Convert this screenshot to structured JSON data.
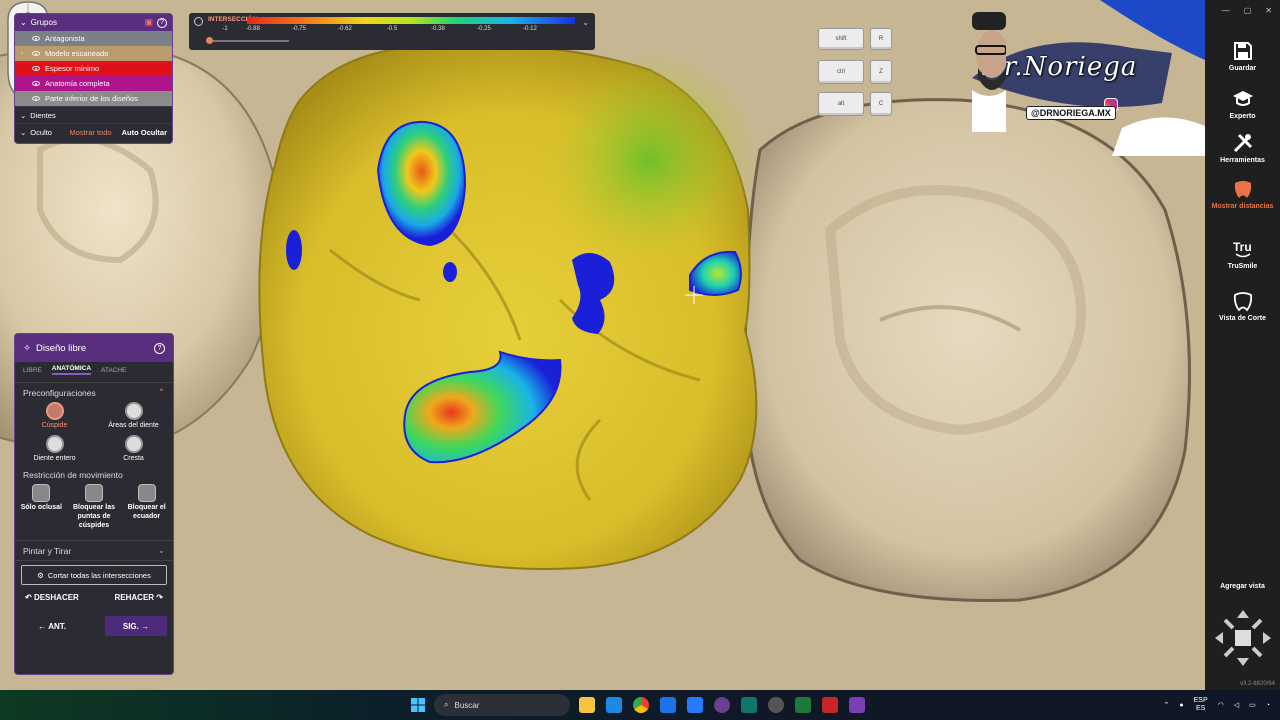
{
  "groups_panel": {
    "title": "Grupos",
    "layers": [
      {
        "label": "Antagonista",
        "bg": "#7a7f88",
        "arrow": ""
      },
      {
        "label": "Modelo escaneado",
        "bg": "#b99b6e",
        "arrow": "›"
      },
      {
        "label": "Espesor mínimo",
        "bg": "#e0101a",
        "arrow": ""
      },
      {
        "label": "Anatomía completa",
        "bg": "#b0148a",
        "arrow": ""
      },
      {
        "label": "Parte inferior de los diseños",
        "bg": "#8b8b8b",
        "arrow": ""
      }
    ],
    "teeth_label": "Dientes",
    "hidden_label": "Oculto",
    "show_all_label": "Mostrar todo",
    "auto_hide_label": "Auto Ocultar"
  },
  "intersection_bar": {
    "title": "INTERSECCIÓN",
    "ticks": [
      "-1",
      "-0.88",
      "-0.75",
      "-0.62",
      "-0.5",
      "-0.38",
      "-0.25",
      "-0.12"
    ],
    "slider_value": 0
  },
  "keys": {
    "shift": "shift",
    "ctrl": "ctrl",
    "alt": "alt",
    "r": "R",
    "z": "Z",
    "c": "C"
  },
  "logo": {
    "signature": "Dr.Noriega",
    "handle": "@DRNORIEGA.MX"
  },
  "design_panel": {
    "title": "Diseño libre",
    "tabs": [
      "LIBRE",
      "ANATÓMICA",
      "ATACHE"
    ],
    "active_tab": "ANATÓMICA",
    "presets_title": "Preconfiguraciones",
    "presets": [
      "Cúspide",
      "Áreas del diente",
      "Diente entero",
      "Cresta"
    ],
    "selected_preset": "Cúspide",
    "restriction_title": "Restricción de movimiento",
    "restrictions": [
      "Sólo oclusal",
      "Bloquear las puntas de cúspides",
      "Bloquear el ecuador"
    ],
    "paint_pull": "Pintar y Tirar",
    "cut_all": "Cortar todas las intersecciones",
    "undo": "DESHACER",
    "redo": "REHACER",
    "prev": "ANT.",
    "next": "SIG."
  },
  "sidebar": {
    "items": [
      {
        "label": "Guardar",
        "icon": "save-icon"
      },
      {
        "label": "Experto",
        "icon": "graduation-cap-icon"
      },
      {
        "label": "Herramientas",
        "icon": "tools-icon"
      },
      {
        "label": "Mostrar distancias",
        "icon": "tooth-distance-icon"
      },
      {
        "label": "TruSmile",
        "icon": "trusmile-icon"
      },
      {
        "label": "Vista de Corte",
        "icon": "tooth-section-icon"
      }
    ],
    "active_item": "Mostrar distancias",
    "add_view": "Agregar vista",
    "version": "v3.2-8820/64"
  },
  "taskbar": {
    "search_placeholder": "Buscar",
    "lang_top": "ESP",
    "lang_bottom": "ES"
  }
}
